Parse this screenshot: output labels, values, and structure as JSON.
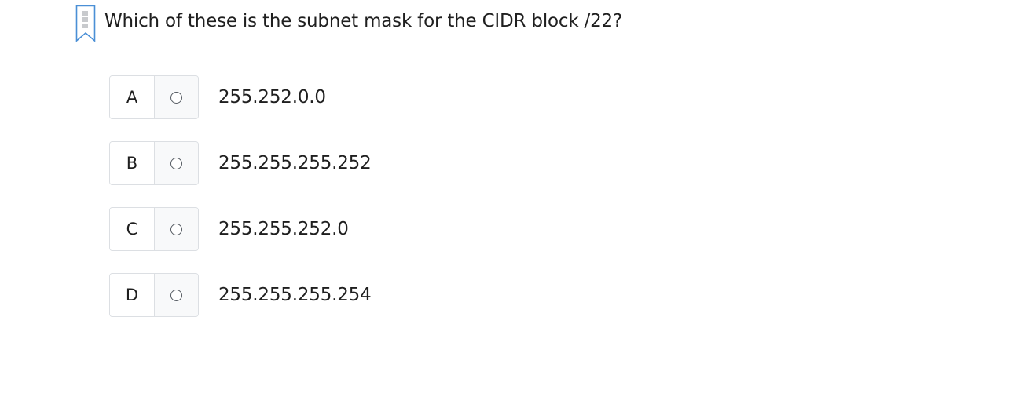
{
  "question": {
    "text": "Which of these is the subnet mask for the CIDR block /22?",
    "bookmark_icon": "bookmark-flag-icon"
  },
  "options": [
    {
      "letter": "A",
      "text": "255.252.0.0",
      "selected": false
    },
    {
      "letter": "B",
      "text": "255.255.255.252",
      "selected": false
    },
    {
      "letter": "C",
      "text": "255.255.252.0",
      "selected": false
    },
    {
      "letter": "D",
      "text": "255.255.255.254",
      "selected": false
    }
  ],
  "colors": {
    "border": "#dcdfe3",
    "radio_cell_bg": "#f8f9fa",
    "bookmark_stroke": "#4a8fd6",
    "bookmark_fill": "#c8cacd"
  }
}
